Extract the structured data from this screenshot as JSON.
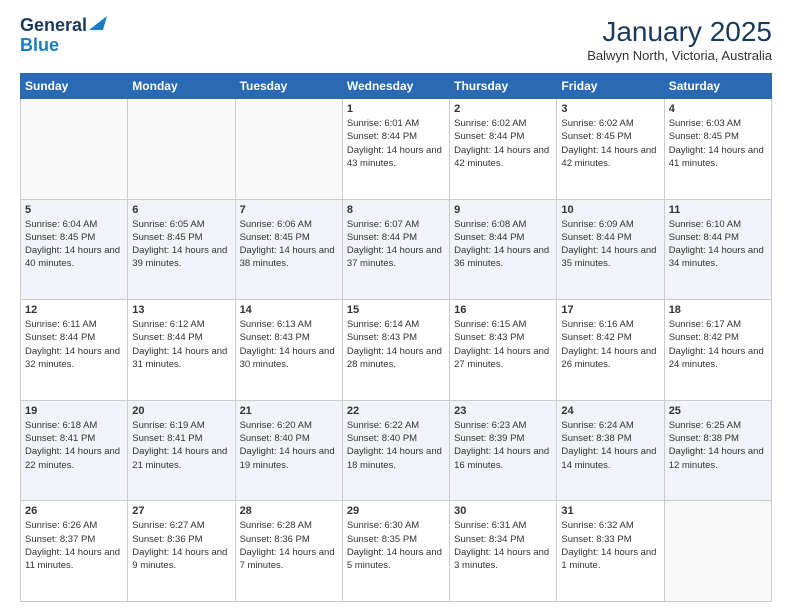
{
  "logo": {
    "line1": "General",
    "line2": "Blue"
  },
  "title": "January 2025",
  "subtitle": "Balwyn North, Victoria, Australia",
  "days_header": [
    "Sunday",
    "Monday",
    "Tuesday",
    "Wednesday",
    "Thursday",
    "Friday",
    "Saturday"
  ],
  "weeks": [
    [
      {
        "day": "",
        "info": ""
      },
      {
        "day": "",
        "info": ""
      },
      {
        "day": "",
        "info": ""
      },
      {
        "day": "1",
        "sunrise": "6:01 AM",
        "sunset": "8:44 PM",
        "daylight": "14 hours and 43 minutes."
      },
      {
        "day": "2",
        "sunrise": "6:02 AM",
        "sunset": "8:44 PM",
        "daylight": "14 hours and 42 minutes."
      },
      {
        "day": "3",
        "sunrise": "6:02 AM",
        "sunset": "8:45 PM",
        "daylight": "14 hours and 42 minutes."
      },
      {
        "day": "4",
        "sunrise": "6:03 AM",
        "sunset": "8:45 PM",
        "daylight": "14 hours and 41 minutes."
      }
    ],
    [
      {
        "day": "5",
        "sunrise": "6:04 AM",
        "sunset": "8:45 PM",
        "daylight": "14 hours and 40 minutes."
      },
      {
        "day": "6",
        "sunrise": "6:05 AM",
        "sunset": "8:45 PM",
        "daylight": "14 hours and 39 minutes."
      },
      {
        "day": "7",
        "sunrise": "6:06 AM",
        "sunset": "8:45 PM",
        "daylight": "14 hours and 38 minutes."
      },
      {
        "day": "8",
        "sunrise": "6:07 AM",
        "sunset": "8:44 PM",
        "daylight": "14 hours and 37 minutes."
      },
      {
        "day": "9",
        "sunrise": "6:08 AM",
        "sunset": "8:44 PM",
        "daylight": "14 hours and 36 minutes."
      },
      {
        "day": "10",
        "sunrise": "6:09 AM",
        "sunset": "8:44 PM",
        "daylight": "14 hours and 35 minutes."
      },
      {
        "day": "11",
        "sunrise": "6:10 AM",
        "sunset": "8:44 PM",
        "daylight": "14 hours and 34 minutes."
      }
    ],
    [
      {
        "day": "12",
        "sunrise": "6:11 AM",
        "sunset": "8:44 PM",
        "daylight": "14 hours and 32 minutes."
      },
      {
        "day": "13",
        "sunrise": "6:12 AM",
        "sunset": "8:44 PM",
        "daylight": "14 hours and 31 minutes."
      },
      {
        "day": "14",
        "sunrise": "6:13 AM",
        "sunset": "8:43 PM",
        "daylight": "14 hours and 30 minutes."
      },
      {
        "day": "15",
        "sunrise": "6:14 AM",
        "sunset": "8:43 PM",
        "daylight": "14 hours and 28 minutes."
      },
      {
        "day": "16",
        "sunrise": "6:15 AM",
        "sunset": "8:43 PM",
        "daylight": "14 hours and 27 minutes."
      },
      {
        "day": "17",
        "sunrise": "6:16 AM",
        "sunset": "8:42 PM",
        "daylight": "14 hours and 26 minutes."
      },
      {
        "day": "18",
        "sunrise": "6:17 AM",
        "sunset": "8:42 PM",
        "daylight": "14 hours and 24 minutes."
      }
    ],
    [
      {
        "day": "19",
        "sunrise": "6:18 AM",
        "sunset": "8:41 PM",
        "daylight": "14 hours and 22 minutes."
      },
      {
        "day": "20",
        "sunrise": "6:19 AM",
        "sunset": "8:41 PM",
        "daylight": "14 hours and 21 minutes."
      },
      {
        "day": "21",
        "sunrise": "6:20 AM",
        "sunset": "8:40 PM",
        "daylight": "14 hours and 19 minutes."
      },
      {
        "day": "22",
        "sunrise": "6:22 AM",
        "sunset": "8:40 PM",
        "daylight": "14 hours and 18 minutes."
      },
      {
        "day": "23",
        "sunrise": "6:23 AM",
        "sunset": "8:39 PM",
        "daylight": "14 hours and 16 minutes."
      },
      {
        "day": "24",
        "sunrise": "6:24 AM",
        "sunset": "8:38 PM",
        "daylight": "14 hours and 14 minutes."
      },
      {
        "day": "25",
        "sunrise": "6:25 AM",
        "sunset": "8:38 PM",
        "daylight": "14 hours and 12 minutes."
      }
    ],
    [
      {
        "day": "26",
        "sunrise": "6:26 AM",
        "sunset": "8:37 PM",
        "daylight": "14 hours and 11 minutes."
      },
      {
        "day": "27",
        "sunrise": "6:27 AM",
        "sunset": "8:36 PM",
        "daylight": "14 hours and 9 minutes."
      },
      {
        "day": "28",
        "sunrise": "6:28 AM",
        "sunset": "8:36 PM",
        "daylight": "14 hours and 7 minutes."
      },
      {
        "day": "29",
        "sunrise": "6:30 AM",
        "sunset": "8:35 PM",
        "daylight": "14 hours and 5 minutes."
      },
      {
        "day": "30",
        "sunrise": "6:31 AM",
        "sunset": "8:34 PM",
        "daylight": "14 hours and 3 minutes."
      },
      {
        "day": "31",
        "sunrise": "6:32 AM",
        "sunset": "8:33 PM",
        "daylight": "14 hours and 1 minute."
      },
      {
        "day": "",
        "info": ""
      }
    ]
  ]
}
